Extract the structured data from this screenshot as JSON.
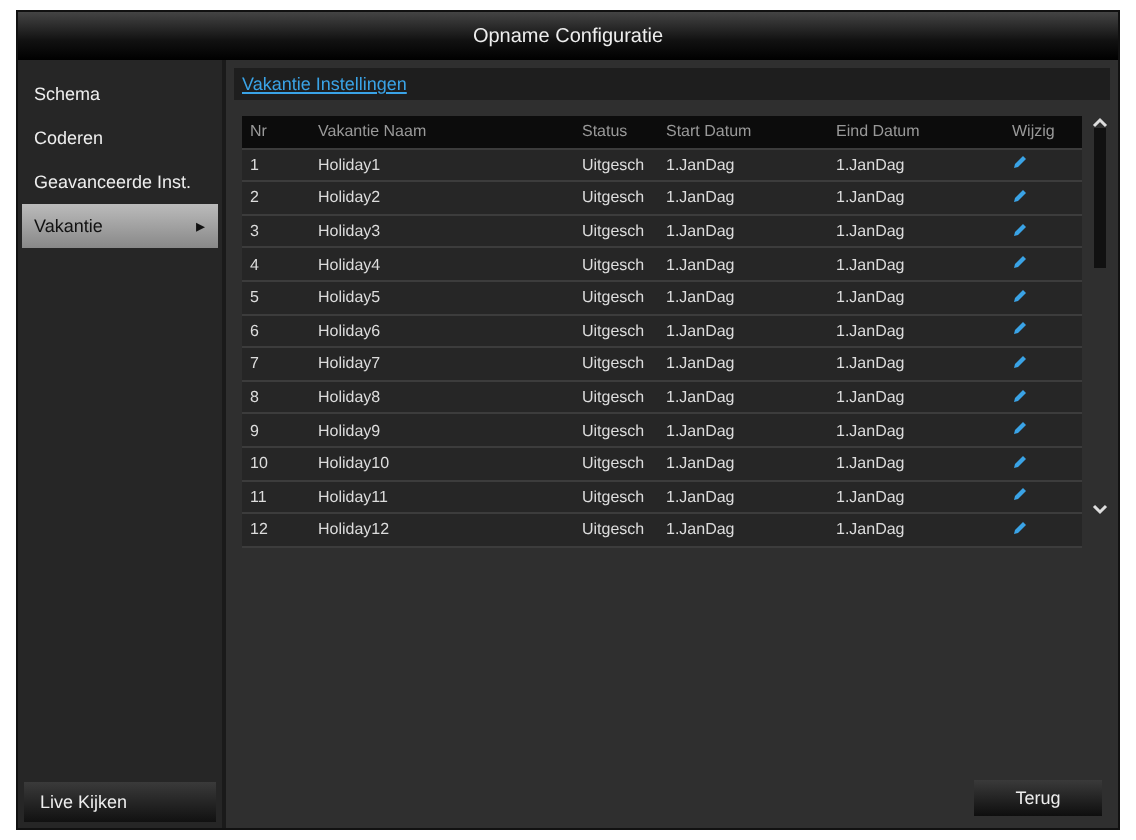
{
  "window": {
    "title": "Opname Configuratie"
  },
  "sidebar": {
    "items": [
      {
        "label": "Schema",
        "selected": false
      },
      {
        "label": "Coderen",
        "selected": false
      },
      {
        "label": "Geavanceerde Inst.",
        "selected": false
      },
      {
        "label": "Vakantie",
        "selected": true,
        "arrow": "▸"
      }
    ],
    "bottom_button": "Live Kijken"
  },
  "tab": {
    "label": "Vakantie Instellingen"
  },
  "table": {
    "columns": [
      "Nr",
      "Vakantie Naam",
      "Status",
      "Start Datum",
      "Eind Datum",
      "Wijzig"
    ],
    "rows": [
      [
        "1",
        "Holiday1",
        "Uitgesch",
        "1.JanDag",
        "1.JanDag"
      ],
      [
        "2",
        "Holiday2",
        "Uitgesch",
        "1.JanDag",
        "1.JanDag"
      ],
      [
        "3",
        "Holiday3",
        "Uitgesch",
        "1.JanDag",
        "1.JanDag"
      ],
      [
        "4",
        "Holiday4",
        "Uitgesch",
        "1.JanDag",
        "1.JanDag"
      ],
      [
        "5",
        "Holiday5",
        "Uitgesch",
        "1.JanDag",
        "1.JanDag"
      ],
      [
        "6",
        "Holiday6",
        "Uitgesch",
        "1.JanDag",
        "1.JanDag"
      ],
      [
        "7",
        "Holiday7",
        "Uitgesch",
        "1.JanDag",
        "1.JanDag"
      ],
      [
        "8",
        "Holiday8",
        "Uitgesch",
        "1.JanDag",
        "1.JanDag"
      ],
      [
        "9",
        "Holiday9",
        "Uitgesch",
        "1.JanDag",
        "1.JanDag"
      ],
      [
        "10",
        "Holiday10",
        "Uitgesch",
        "1.JanDag",
        "1.JanDag"
      ],
      [
        "11",
        "Holiday11",
        "Uitgesch",
        "1.JanDag",
        "1.JanDag"
      ],
      [
        "12",
        "Holiday12",
        "Uitgesch",
        "1.JanDag",
        "1.JanDag"
      ]
    ]
  },
  "buttons": [
    "Terug"
  ]
}
